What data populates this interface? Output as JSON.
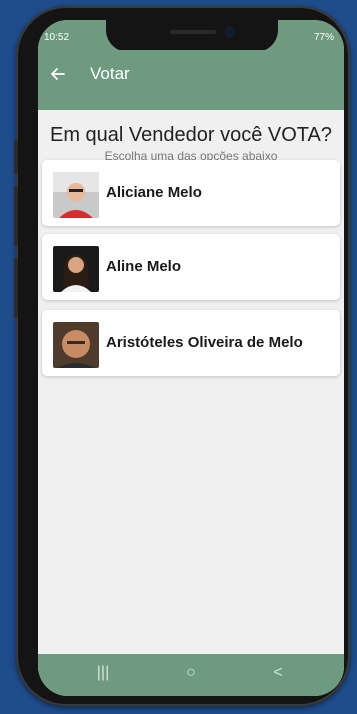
{
  "status_bar": {
    "time": "10:52",
    "right": "77%"
  },
  "app_bar": {
    "title": "Votar",
    "back_icon": "arrow-left-icon"
  },
  "page": {
    "heading": "Em qual Vendedor você VOTA?",
    "subheading": "Escolha uma das opções abaixo"
  },
  "vendors": [
    {
      "name": "Aliciane Melo"
    },
    {
      "name": "Aline Melo"
    },
    {
      "name": "Aristóteles Oliveira de Melo"
    }
  ],
  "nav_bar": {
    "recents": "|||",
    "home": "○",
    "back": "<"
  },
  "colors": {
    "background": "#1f4d8c",
    "app_bar": "#6e9a80",
    "screen": "#f0f0f0"
  }
}
